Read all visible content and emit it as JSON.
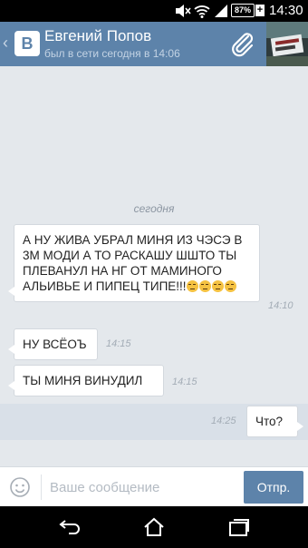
{
  "status_bar": {
    "battery": "87%",
    "charging": "+",
    "time": "14:30",
    "icons": [
      "mute-icon",
      "wifi-icon",
      "signal-icon",
      "battery-icon"
    ]
  },
  "header": {
    "logo": "B",
    "contact_name": "Евгений Попов",
    "contact_status": "был в сети сегодня в 14:06",
    "icons": [
      "back-chevron-icon",
      "paperclip-icon"
    ]
  },
  "chat": {
    "date_label": "сегодня",
    "messages": [
      {
        "direction": "in",
        "text": "А НУ ЖИВА УБРАЛ МИНЯ ИЗ ЧЭСЭ В 3М МОДИ А ТО РАСКАШУ ШШТО ТЫ ПЛЕВАНУЛ НА НГ ОТ МАМИНОГО АЛЬИВЬЕ И ПИПЕЦ ТИПЕ!!!",
        "emoji": [
          "😒",
          "😒",
          "😒",
          "😒"
        ],
        "time": "14:10"
      },
      {
        "direction": "in",
        "text": "НУ ВСЁОЪ",
        "time": "14:15"
      },
      {
        "direction": "in",
        "text": "ТЫ МИНЯ ВИНУДИЛ",
        "time": "14:15"
      },
      {
        "direction": "out",
        "text": "Что?",
        "time": "14:25"
      }
    ]
  },
  "composer": {
    "placeholder": "Ваше сообщение",
    "send_label": "Отпр."
  },
  "colors": {
    "header": "#5d83aa",
    "chat_bg": "#e4e8ec",
    "out_row_bg": "#d9e0e8",
    "send_button": "#5d83aa"
  }
}
